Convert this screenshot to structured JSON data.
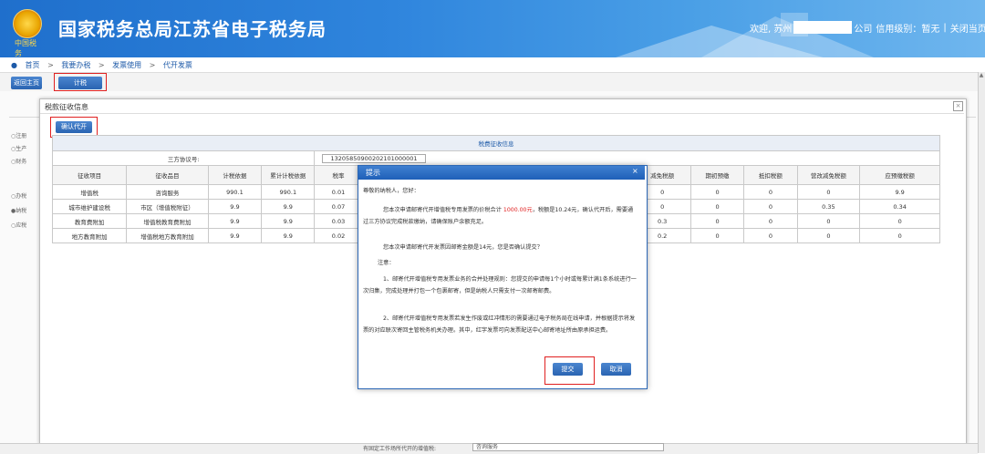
{
  "header": {
    "title": "国家税务总局江苏省电子税务局",
    "emblem_text": "中国税务",
    "welcome": "欢迎, 苏州",
    "company_suffix": "公司",
    "credit_label": "信用级别：暂无",
    "divider": "|",
    "close_page": "关闭当页"
  },
  "breadcrumb": {
    "items": [
      "首页",
      "我要办税",
      "发票使用",
      "代开发票"
    ],
    "separator": ">"
  },
  "toolbar": {
    "back_label": "返回主页",
    "calc_label": "计税"
  },
  "background_page": {
    "labels": [
      "注册",
      "生产",
      "财务",
      "办税",
      "纳税",
      "应税"
    ]
  },
  "dialog": {
    "title": "税款征收信息",
    "confirm_label": "确认代开",
    "close_label": "×",
    "section_title": "税费征收信息",
    "agreement_label": "三方协议号:",
    "agreement_value": "13205850900202101000001",
    "columns": [
      "征收项目",
      "征收品目",
      "计税依据",
      "累计计税依据",
      "税率",
      "",
      "",
      "",
      "",
      "",
      "减免税额",
      "期初预缴",
      "抵扣税额",
      "营改减免税额",
      "应预缴税额"
    ],
    "rows": [
      [
        "增值税",
        "咨询服务",
        "990.1",
        "990.1",
        "0.01",
        "",
        "",
        "",
        "",
        "",
        "0",
        "0",
        "0",
        "0",
        "9.9"
      ],
      [
        "城市维护建设税",
        "市区（增值税附征）",
        "9.9",
        "9.9",
        "0.07",
        "",
        "",
        "",
        "",
        "",
        "0",
        "0",
        "0",
        "0.35",
        "0.34"
      ],
      [
        "教育费附加",
        "增值税教育费附加",
        "9.9",
        "9.9",
        "0.03",
        "",
        "",
        "",
        "",
        "",
        "0.3",
        "0",
        "0",
        "0",
        "0"
      ],
      [
        "地方教育附加",
        "增值税地方教育附加",
        "9.9",
        "9.9",
        "0.02",
        "",
        "",
        "",
        "",
        "",
        "0.2",
        "0",
        "0",
        "0",
        "0"
      ]
    ]
  },
  "modal": {
    "title": "提示",
    "close": "×",
    "greeting": "尊敬的纳税人，您好：",
    "p1_before": "您本次申请邮寄代开增值税专用发票的价税合计 ",
    "p1_amount": "1000.00元",
    "p1_after": "，税额是10.24元，确认代开后，需要通过三方协议完成税款缴纳，请确保账户余额充足。",
    "p2": "您本次申请邮寄代开发票因邮寄金额是14元，您是否确认提交？",
    "note_label": "注意：",
    "n1": "1、邮寄代开增值税专用发票业务的合并处理规则：您提交的申请每1个小时或每累计满1条系统进行一次归集，完成处理并打包一个包裹邮寄，但是纳税人只需支付一次邮寄邮费。",
    "n2": "2、邮寄代开增值税专用发票若发生作废或红冲情形的需要通过电子税务局在线申请，并根据提示将发票的对应联次寄回主管税务机关办理。其中，红字发票可向发票配送中心邮寄地址所由原承担运费。",
    "submit_label": "提交",
    "cancel_label": "取消"
  },
  "bottom": {
    "label": "有固定工作场所代开的增值税:",
    "select_value": "咨询服务"
  }
}
